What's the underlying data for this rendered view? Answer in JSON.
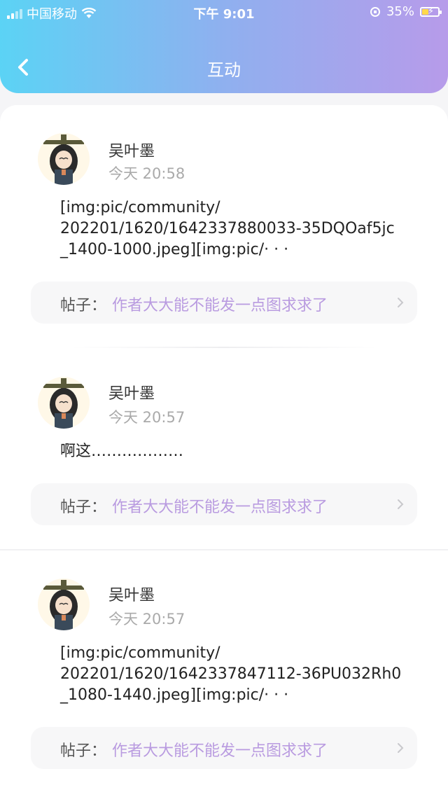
{
  "status": {
    "carrier": "中国移动",
    "time": "下午 9:01",
    "battery": "35%",
    "signal_icon": "signal-icon",
    "wifi_icon": "wifi-icon"
  },
  "header": {
    "title": "互动",
    "back_icon": "chevron-left-icon"
  },
  "colors": {
    "gradient_start": "#5bd3f5",
    "gradient_end": "#b79bea",
    "post_title": "#b99be0"
  },
  "items": [
    {
      "username": "吴叶墨",
      "time": "今天 20:58",
      "content": "[img:pic/community/\n202201/1620/1642337880033-35DQOaf5jc\n_1400-1000.jpeg][img:pic/· · ·",
      "post_prefix": "帖子：",
      "post_title": "作者大大能不能发一点图求求了"
    },
    {
      "username": "吴叶墨",
      "time": "今天 20:57",
      "content": "啊这………………",
      "post_prefix": "帖子：",
      "post_title": "作者大大能不能发一点图求求了"
    },
    {
      "username": "吴叶墨",
      "time": "今天 20:57",
      "content": "[img:pic/community/\n202201/1620/1642337847112-36PU032Rh0\n_1080-1440.jpeg][img:pic/· · ·",
      "post_prefix": "帖子：",
      "post_title": "作者大大能不能发一点图求求了"
    }
  ]
}
